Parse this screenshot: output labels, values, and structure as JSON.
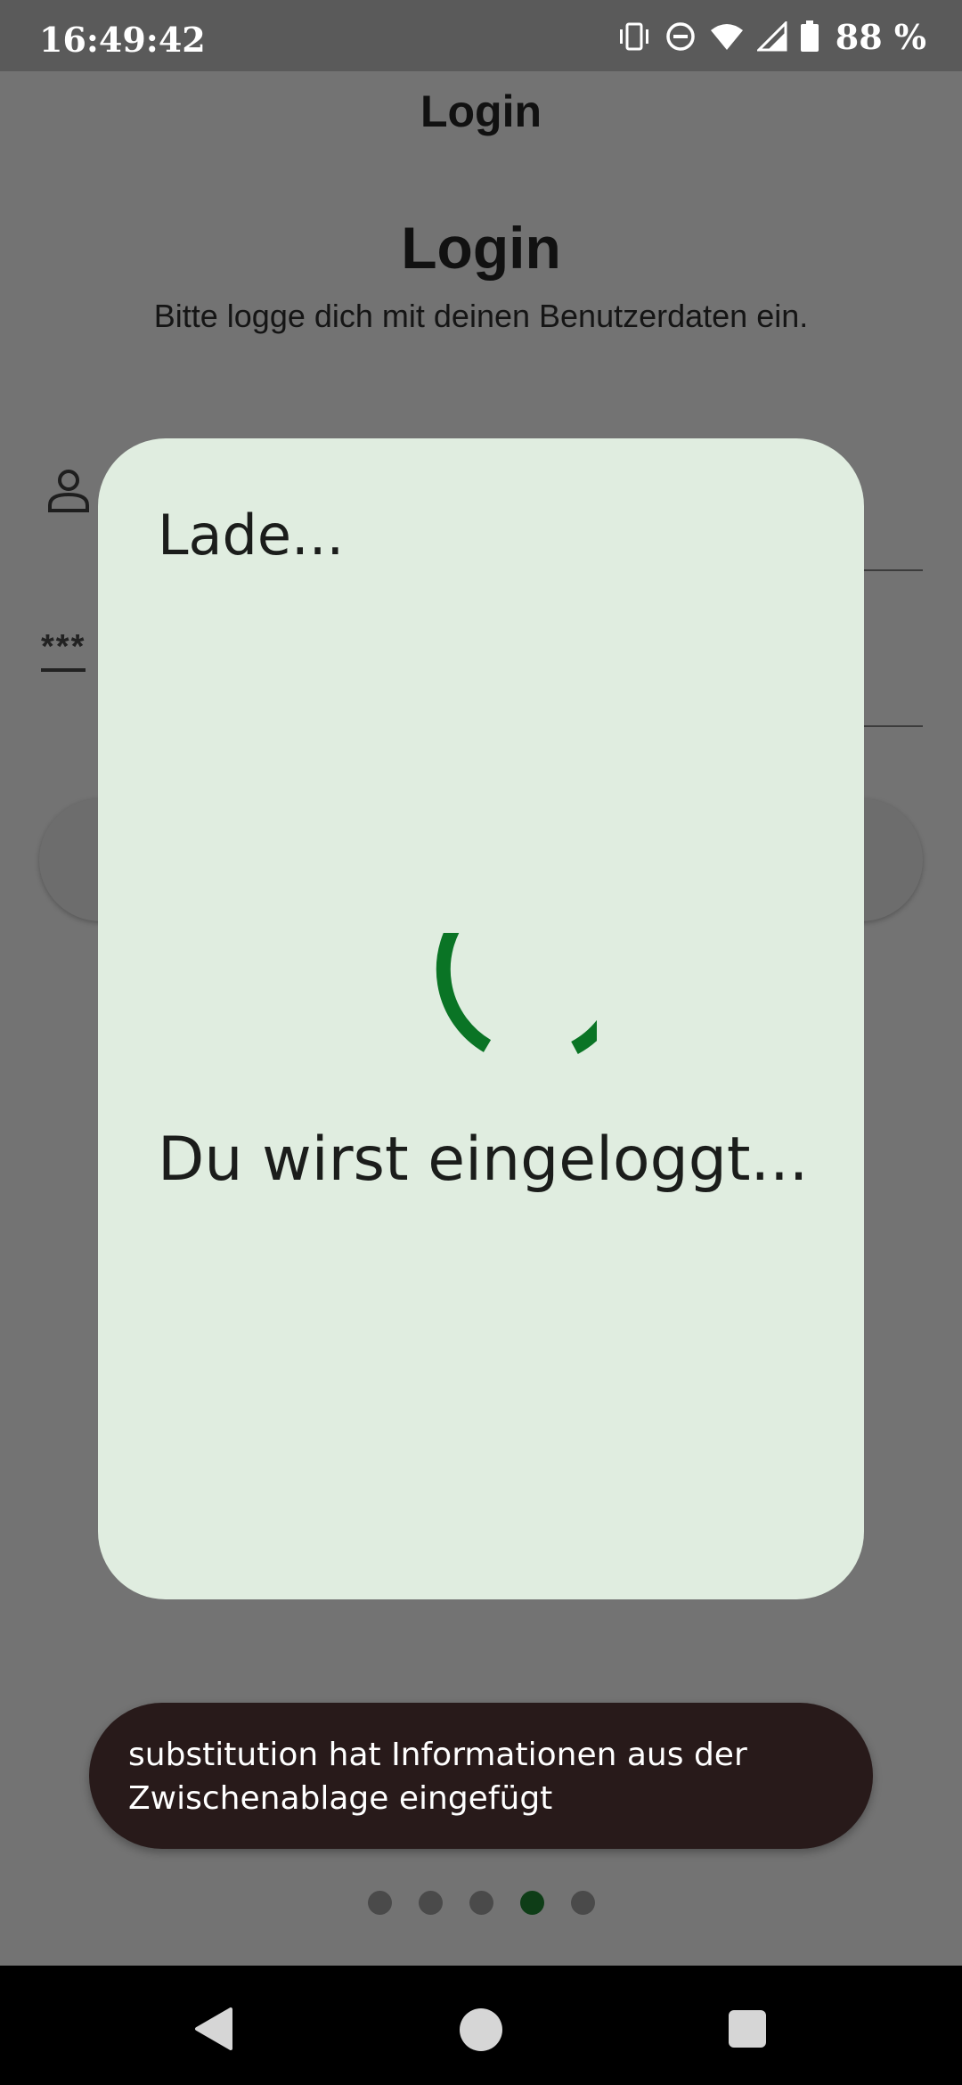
{
  "status_bar": {
    "time": "16:49:42",
    "battery_percent": "88 %",
    "icons": [
      "vibrate-icon",
      "do-not-disturb-icon",
      "wifi-icon",
      "cell-signal-icon",
      "battery-icon"
    ]
  },
  "app": {
    "appbar_title": "Login",
    "heading": "Login",
    "subheading": "Bitte logge dich mit deinen Benutzerdaten ein.",
    "password_icon_text": "***"
  },
  "dialog": {
    "title": "Lade...",
    "message": "Du wirst eingeloggt...",
    "spinner_color": "#0a7425",
    "background_color": "#e0ede0"
  },
  "toast": {
    "text": "substitution hat Informationen aus der Zwischenablage eingefügt"
  },
  "page_indicator": {
    "count": 5,
    "active_index": 3
  },
  "nav_bar": {
    "icons": [
      "back-icon",
      "home-icon",
      "recent-apps-icon"
    ]
  }
}
